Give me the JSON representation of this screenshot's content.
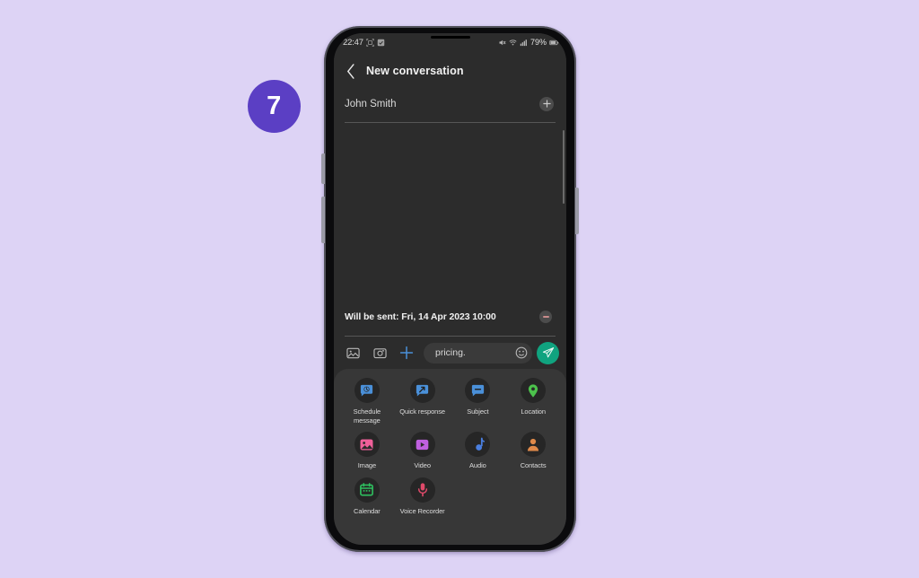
{
  "page": {
    "background_color": "#ddd3f5",
    "step_badge": {
      "number": "7",
      "color": "#5b3fc4"
    }
  },
  "phone": {
    "statusbar": {
      "time": "22:47",
      "left_icons": [
        "screenshot-icon",
        "checkbox-icon"
      ],
      "right_icons": [
        "mute-icon",
        "wifi-icon",
        "signal-icon"
      ],
      "battery_percent": "79%",
      "battery_icon": "battery-icon"
    },
    "appbar": {
      "back_icon": "chevron-left-icon",
      "title": "New conversation"
    },
    "recipient": {
      "value": "John Smith",
      "placeholder": "Recipient",
      "add_icon": "plus-circle-icon"
    },
    "scheduled": {
      "text": "Will be sent: Fri, 14 Apr 2023 10:00",
      "remove_icon": "minus-circle-icon"
    },
    "composer": {
      "gallery_icon": "image-icon",
      "camera_icon": "camera-icon",
      "plus_icon": "plus-icon",
      "plus_color": "#4a90d9",
      "input_value": "pricing.",
      "input_placeholder": "Text message",
      "emoji_icon": "emoji-icon",
      "send_icon": "send-icon",
      "send_color": "#10a37f"
    },
    "attachments": {
      "items": [
        {
          "label": "Schedule message",
          "icon": "schedule-message-icon",
          "color": "#4a90d9"
        },
        {
          "label": "Quick response",
          "icon": "quick-response-icon",
          "color": "#4a90d9"
        },
        {
          "label": "Subject",
          "icon": "subject-icon",
          "color": "#4a90d9"
        },
        {
          "label": "Location",
          "icon": "location-pin-icon",
          "color": "#4cc24c"
        },
        {
          "label": "Image",
          "icon": "image-icon",
          "color": "#f0609a"
        },
        {
          "label": "Video",
          "icon": "video-play-icon",
          "color": "#c060e0"
        },
        {
          "label": "Audio",
          "icon": "audio-note-icon",
          "color": "#4a7fe0"
        },
        {
          "label": "Contacts",
          "icon": "contact-person-icon",
          "color": "#e08a4a"
        },
        {
          "label": "Calendar",
          "icon": "calendar-icon",
          "color": "#2fbf5f"
        },
        {
          "label": "Voice Recorder",
          "icon": "microphone-icon",
          "color": "#e04a6a"
        }
      ]
    }
  }
}
